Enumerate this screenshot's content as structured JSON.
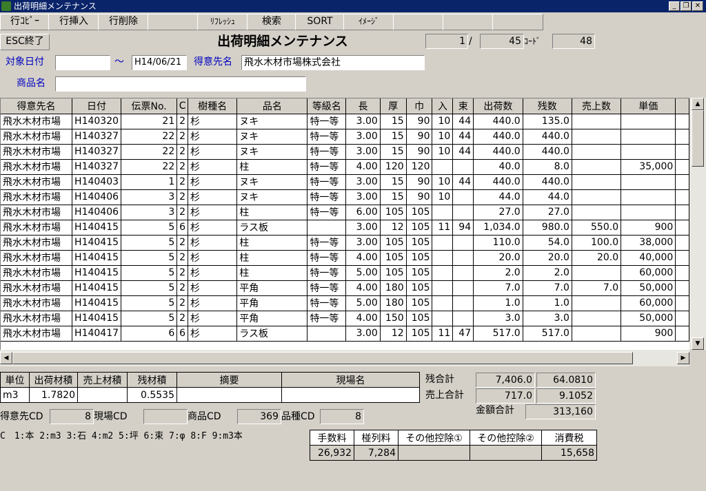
{
  "window": {
    "title": "出荷明細メンテナンス"
  },
  "toolbar": [
    "行ｺﾋﾟｰ",
    "行挿入",
    "行削除",
    "",
    "ﾘﾌﾚｯｼｭ",
    "検索",
    "SORT",
    "ｲﾒｰｼﾞ",
    "",
    "",
    ""
  ],
  "header": {
    "esc_label": "ESC終了",
    "title": "出荷明細メンテナンス",
    "page_current": "1",
    "page_sep": "/",
    "page_total": "45",
    "code_label": "ｺｰﾄﾞ",
    "code_value": "48"
  },
  "filters": {
    "date_label": "対象日付",
    "date_from": "",
    "tilde": "～",
    "date_to": "H14/06/21",
    "customer_label": "得意先名",
    "customer_value": "飛水木材市場株式会社",
    "product_label": "商品名",
    "product_value": ""
  },
  "table": {
    "headers": [
      "得意先名",
      "日付",
      "伝票No.",
      "C",
      "樹種名",
      "品名",
      "等級名",
      "長",
      "厚",
      "巾",
      "入",
      "束",
      "出荷数",
      "残数",
      "売上数",
      "単価"
    ],
    "rows": [
      [
        "飛水木材市場",
        "H140320",
        "21",
        "2",
        "杉",
        "ヌキ",
        "特一等",
        "3.00",
        "15",
        "90",
        "10",
        "44",
        "440.0",
        "135.0",
        "",
        ""
      ],
      [
        "飛水木材市場",
        "H140327",
        "22",
        "2",
        "杉",
        "ヌキ",
        "特一等",
        "3.00",
        "15",
        "90",
        "10",
        "44",
        "440.0",
        "440.0",
        "",
        ""
      ],
      [
        "飛水木材市場",
        "H140327",
        "22",
        "2",
        "杉",
        "ヌキ",
        "特一等",
        "3.00",
        "15",
        "90",
        "10",
        "44",
        "440.0",
        "440.0",
        "",
        ""
      ],
      [
        "飛水木材市場",
        "H140327",
        "22",
        "2",
        "杉",
        "柱",
        "特一等",
        "4.00",
        "120",
        "120",
        "",
        "",
        "40.0",
        "8.0",
        "",
        "35,000"
      ],
      [
        "飛水木材市場",
        "H140403",
        "1",
        "2",
        "杉",
        "ヌキ",
        "特一等",
        "3.00",
        "15",
        "90",
        "10",
        "44",
        "440.0",
        "440.0",
        "",
        ""
      ],
      [
        "飛水木材市場",
        "H140406",
        "3",
        "2",
        "杉",
        "ヌキ",
        "特一等",
        "3.00",
        "15",
        "90",
        "10",
        "",
        "44.0",
        "44.0",
        "",
        ""
      ],
      [
        "飛水木材市場",
        "H140406",
        "3",
        "2",
        "杉",
        "柱",
        "特一等",
        "6.00",
        "105",
        "105",
        "",
        "",
        "27.0",
        "27.0",
        "",
        ""
      ],
      [
        "飛水木材市場",
        "H140415",
        "5",
        "6",
        "杉",
        "ラス板",
        "",
        "3.00",
        "12",
        "105",
        "11",
        "94",
        "1,034.0",
        "980.0",
        "550.0",
        "900"
      ],
      [
        "飛水木材市場",
        "H140415",
        "5",
        "2",
        "杉",
        "柱",
        "特一等",
        "3.00",
        "105",
        "105",
        "",
        "",
        "110.0",
        "54.0",
        "100.0",
        "38,000"
      ],
      [
        "飛水木材市場",
        "H140415",
        "5",
        "2",
        "杉",
        "柱",
        "特一等",
        "4.00",
        "105",
        "105",
        "",
        "",
        "20.0",
        "20.0",
        "20.0",
        "40,000"
      ],
      [
        "飛水木材市場",
        "H140415",
        "5",
        "2",
        "杉",
        "柱",
        "特一等",
        "5.00",
        "105",
        "105",
        "",
        "",
        "2.0",
        "2.0",
        "",
        "60,000"
      ],
      [
        "飛水木材市場",
        "H140415",
        "5",
        "2",
        "杉",
        "平角",
        "特一等",
        "4.00",
        "180",
        "105",
        "",
        "",
        "7.0",
        "7.0",
        "7.0",
        "50,000"
      ],
      [
        "飛水木材市場",
        "H140415",
        "5",
        "2",
        "杉",
        "平角",
        "特一等",
        "5.00",
        "180",
        "105",
        "",
        "",
        "1.0",
        "1.0",
        "",
        "60,000"
      ],
      [
        "飛水木材市場",
        "H140415",
        "5",
        "2",
        "杉",
        "平角",
        "特一等",
        "4.00",
        "150",
        "105",
        "",
        "",
        "3.0",
        "3.0",
        "",
        "50,000"
      ],
      [
        "飛水木材市場",
        "H140417",
        "6",
        "6",
        "杉",
        "ラス板",
        "",
        "3.00",
        "12",
        "105",
        "11",
        "47",
        "517.0",
        "517.0",
        "",
        "900"
      ]
    ]
  },
  "summary": {
    "headers": [
      "単位",
      "出荷材積",
      "売上材積",
      "残材積",
      "摘要",
      "現場名"
    ],
    "values": [
      "m3",
      "1.7820",
      "",
      "0.5535",
      "",
      ""
    ]
  },
  "totals": {
    "remaining_label": "残合計",
    "remaining_qty": "7,406.0",
    "remaining_vol": "64.0810",
    "sales_label": "売上合計",
    "sales_qty": "717.0",
    "sales_vol": "9.1052",
    "amount_label": "金額合計",
    "amount_value": "313,160"
  },
  "codes": {
    "customer_cd_label": "得意先CD",
    "customer_cd": "8",
    "site_cd_label": "現場CD",
    "site_cd": "",
    "product_cd_label": "商品CD",
    "product_cd": "369",
    "species_cd_label": "品種CD",
    "species_cd": "8"
  },
  "legend": "C　1:本 2:m3 3:石 4:m2 5:坪 6:束 7:φ 8:F 9:m3本",
  "fees": {
    "headers": [
      "手数料",
      "椪列料",
      "その他控除①",
      "その他控除②",
      "消費税"
    ],
    "values": [
      "26,932",
      "7,284",
      "",
      "",
      "15,658"
    ]
  }
}
